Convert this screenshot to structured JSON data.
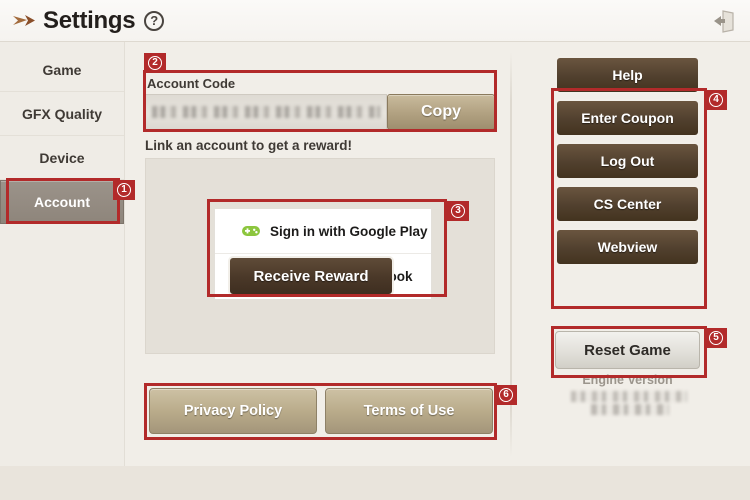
{
  "header": {
    "title": "Settings",
    "logo_icon": "back-chevron-icon",
    "help_icon": "question-mark-icon",
    "help_label": "?",
    "exit_icon": "exit-door-icon"
  },
  "sidebar": {
    "items": [
      {
        "label": "Game",
        "selected": false
      },
      {
        "label": "GFX Quality",
        "selected": false
      },
      {
        "label": "Device",
        "selected": false
      },
      {
        "label": "Account",
        "selected": true
      }
    ]
  },
  "account": {
    "code_label": "Account Code",
    "code_value": "",
    "copy_label": "Copy",
    "link_note": "Link an account to get a reward!",
    "signin": [
      {
        "label": "Sign in with Google Play",
        "icon": "google-play-games-icon",
        "color": "#8cc63e"
      },
      {
        "label": "Sign in with Facebook",
        "icon": "facebook-icon",
        "color": "#1877f2"
      }
    ],
    "receive_reward_label": "Receive Reward",
    "privacy_label": "Privacy Policy",
    "terms_label": "Terms of Use"
  },
  "actions": {
    "buttons": [
      {
        "label": "Help"
      },
      {
        "label": "Enter Coupon"
      },
      {
        "label": "Log Out"
      },
      {
        "label": "CS Center"
      },
      {
        "label": "Webview"
      }
    ],
    "reset_label": "Reset Game",
    "engine_label": "Engine Version",
    "engine_value": ""
  },
  "annotations": [
    {
      "id": "1",
      "number": "1"
    },
    {
      "id": "2",
      "number": "2"
    },
    {
      "id": "3",
      "number": "3"
    },
    {
      "id": "4",
      "number": "4"
    },
    {
      "id": "5",
      "number": "5"
    },
    {
      "id": "6",
      "number": "6"
    }
  ],
  "colors": {
    "annotation": "#b22a2a",
    "dark_button": "#4a3828",
    "tan_button": "#b9ab8a"
  }
}
